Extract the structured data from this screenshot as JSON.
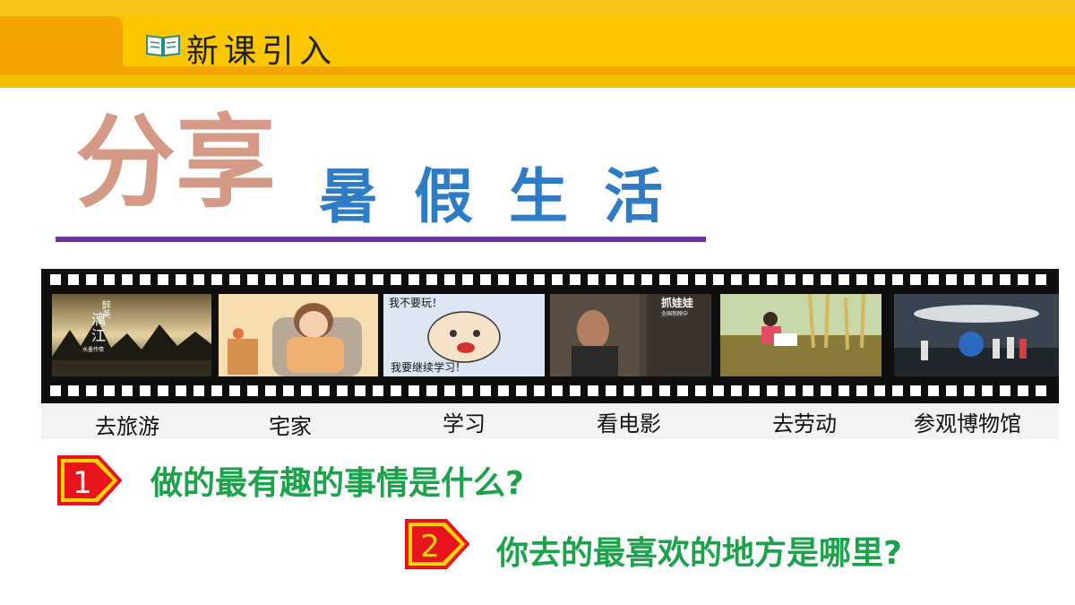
{
  "header": {
    "title": "新课引入",
    "icon": "open-book-icon"
  },
  "title": {
    "main": "分享",
    "subtitle": "暑假生活"
  },
  "film_frames": [
    {
      "label": "去旅游",
      "caption_lines": [
        "醉",
        "美",
        "漓",
        "江"
      ],
      "caption_bottom": "水墨传情"
    },
    {
      "label": "宅家"
    },
    {
      "label": "学习",
      "caption_top": "我不要玩！",
      "caption_bottom": "我要继续学习！"
    },
    {
      "label": "看电影",
      "caption_top": "抓娃娃",
      "caption_small": "全国热映中"
    },
    {
      "label": "去劳动"
    },
    {
      "label": "参观博物馆"
    }
  ],
  "questions": [
    {
      "number": "1",
      "text": "做的最有趣的事情是什么?"
    },
    {
      "number": "2",
      "text": "你去的最喜欢的地方是哪里?"
    }
  ],
  "colors": {
    "header_yellow": "#f5c000",
    "title_blue": "#2f7cc6",
    "question_green": "#1aa34a",
    "badge_red": "#e8141c",
    "badge_yellow": "#f7d500",
    "divider_purple": "#6a35a0"
  }
}
